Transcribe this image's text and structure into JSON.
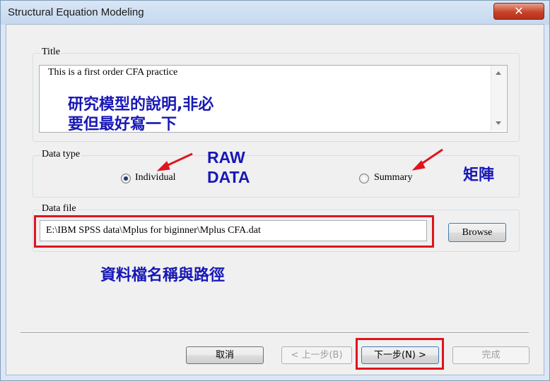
{
  "window": {
    "title": "Structural Equation Modeling",
    "close_glyph": "✕"
  },
  "title_group": {
    "label": "Title",
    "text": "This is a first order CFA practice",
    "note_line1": "研究模型的說明,非必",
    "note_line2": "要但最好寫一下"
  },
  "data_type": {
    "label": "Data type",
    "options": [
      {
        "label": "Individual",
        "selected": true
      },
      {
        "label": "Summary",
        "selected": false
      }
    ],
    "note_raw_line1": "RAW",
    "note_raw_line2": "DATA",
    "note_matrix": "矩陣"
  },
  "data_file": {
    "label": "Data file",
    "value": "E:\\IBM SPSS data\\Mplus for biginner\\Mplus CFA.dat",
    "browse_label": "Browse",
    "note": "資料檔名稱與路徑"
  },
  "buttons": {
    "cancel": "取消",
    "back": "< 上一步(B)",
    "next": "下一步(N) >",
    "finish": "完成"
  },
  "colors": {
    "annotation_blue": "#1717b7",
    "highlight_red": "#e0141e"
  }
}
